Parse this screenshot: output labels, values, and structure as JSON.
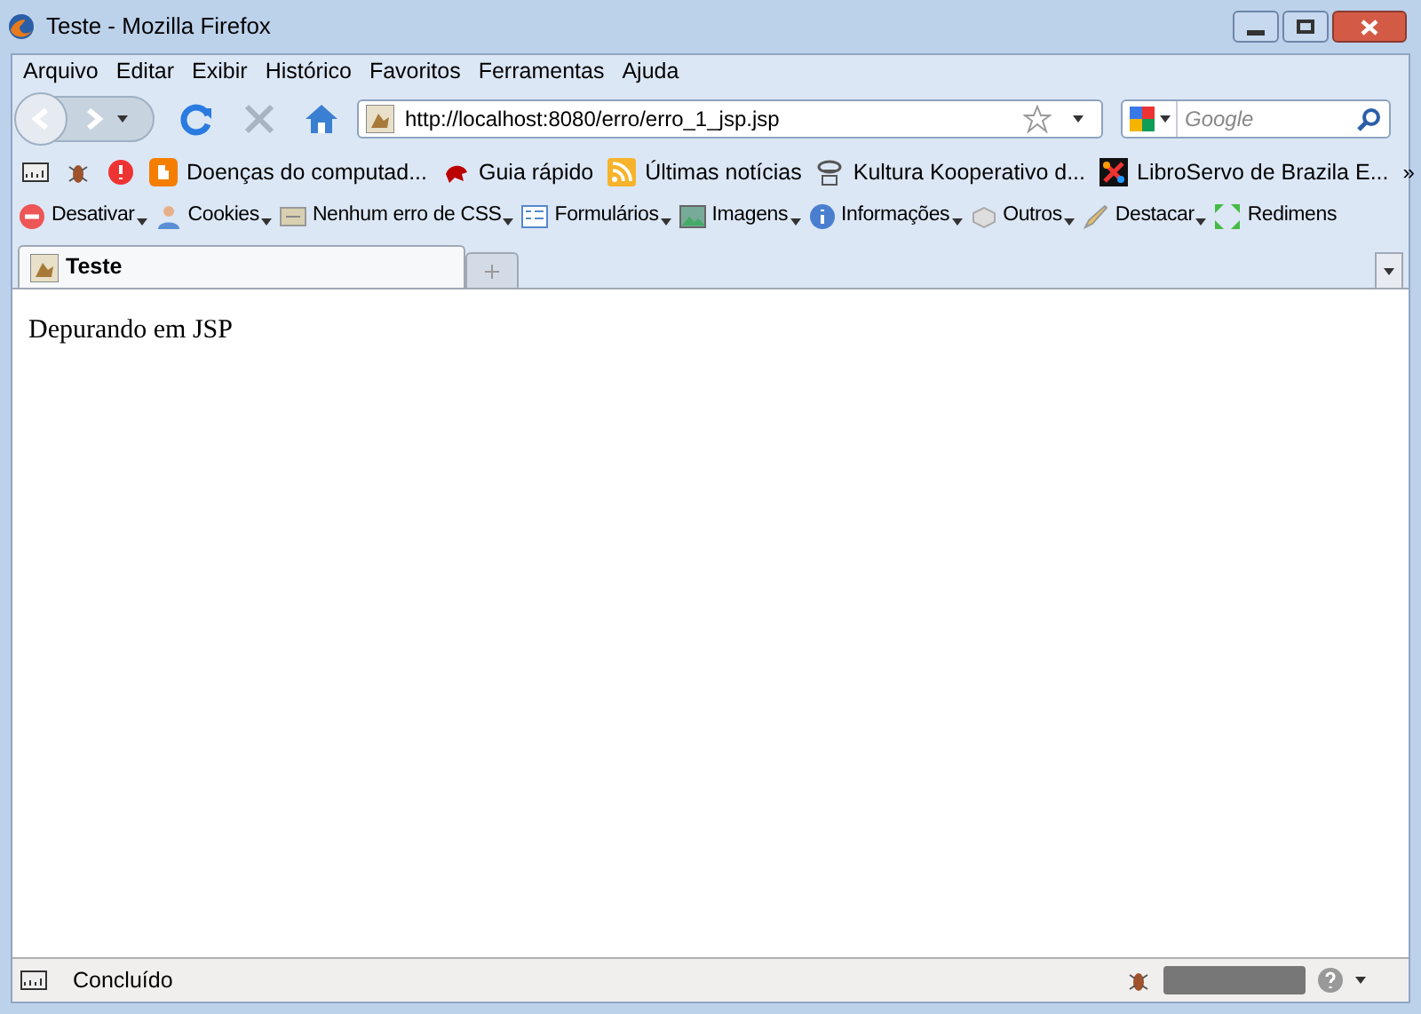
{
  "window": {
    "title": "Teste - Mozilla Firefox"
  },
  "menu": [
    "Arquivo",
    "Editar",
    "Exibir",
    "Histórico",
    "Favoritos",
    "Ferramentas",
    "Ajuda"
  ],
  "navigation": {
    "url": "http://localhost:8080/erro/erro_1_jsp.jsp",
    "search_placeholder": "Google"
  },
  "bookmarks": [
    {
      "kind": "icon"
    },
    {
      "kind": "icon"
    },
    {
      "kind": "icon"
    },
    {
      "kind": "link",
      "label": "Doenças do computad..."
    },
    {
      "kind": "link",
      "label": "Guia rápido"
    },
    {
      "kind": "link",
      "label": "Últimas notícias"
    },
    {
      "kind": "link",
      "label": "Kultura Kooperativo d..."
    },
    {
      "kind": "link",
      "label": "LibroServo de Brazila E..."
    }
  ],
  "bookmarks_overflow": "»",
  "addon_toolbar": [
    {
      "label": "Desativar",
      "dropdown": true
    },
    {
      "label": "Cookies",
      "dropdown": true
    },
    {
      "label": "Nenhum erro de CSS",
      "dropdown": true
    },
    {
      "label": "Formulários",
      "dropdown": true
    },
    {
      "label": "Imagens",
      "dropdown": true
    },
    {
      "label": "Informações",
      "dropdown": true
    },
    {
      "label": "Outros",
      "dropdown": true
    },
    {
      "label": "Destacar",
      "dropdown": true
    },
    {
      "label": "Redimens",
      "dropdown": false
    }
  ],
  "tabs": [
    {
      "label": "Teste",
      "selected": true
    }
  ],
  "page": {
    "text": "Depurando em JSP"
  },
  "status_bar": {
    "text": "Concluído"
  }
}
